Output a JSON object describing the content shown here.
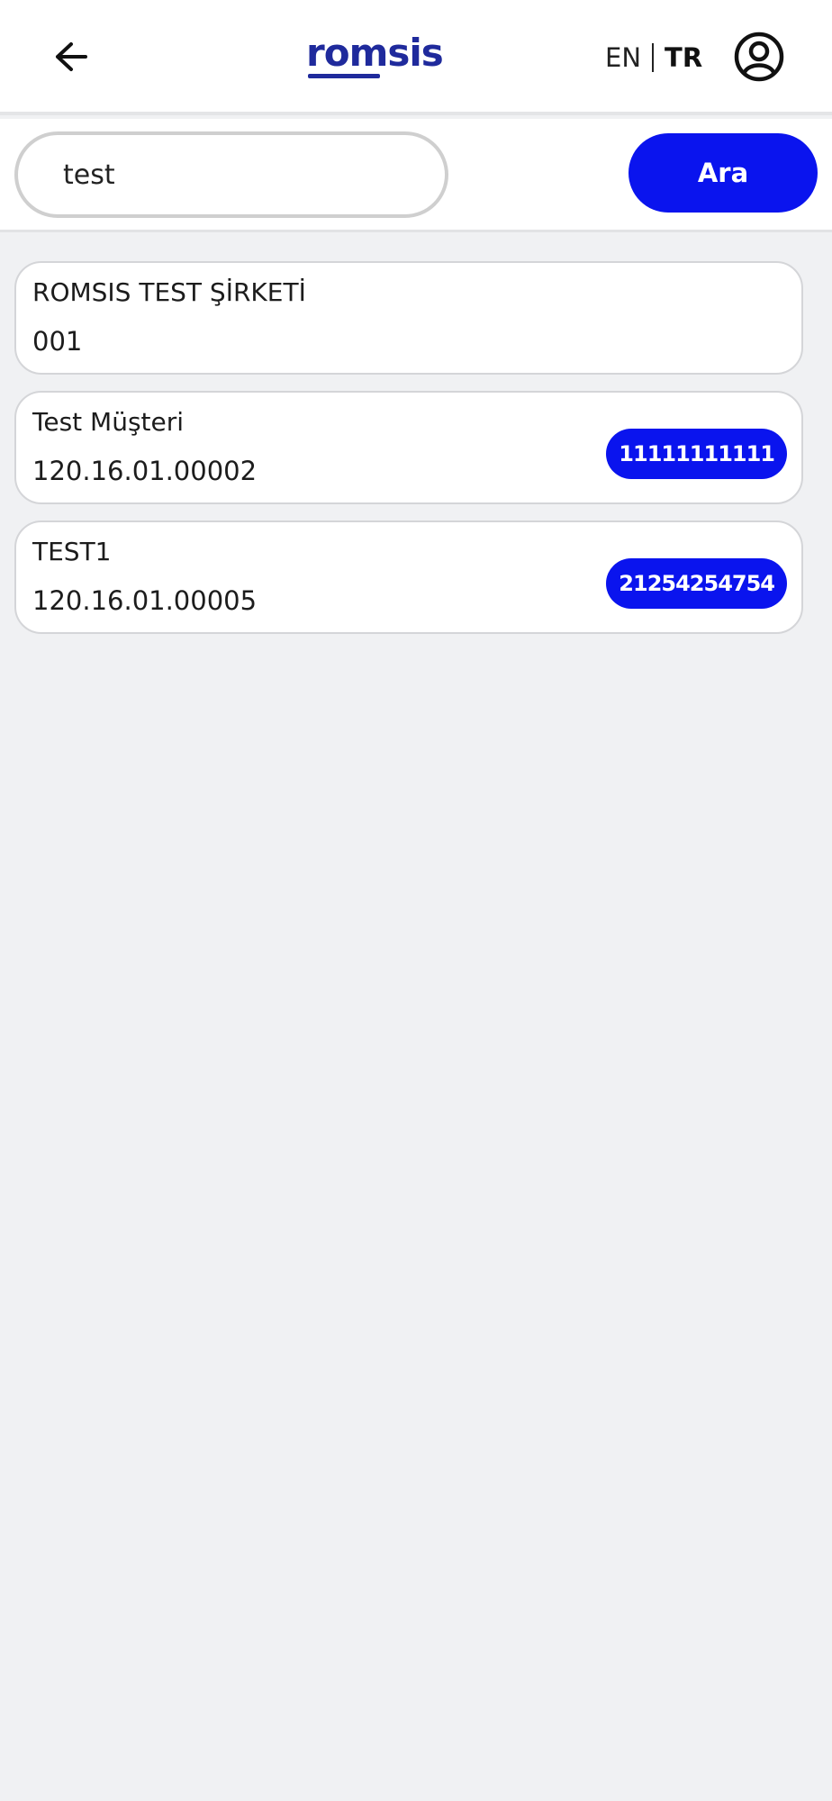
{
  "header": {
    "logo_text": "romsis",
    "lang_en": "EN",
    "lang_tr": "TR"
  },
  "search": {
    "value": "test",
    "button_label": "Ara"
  },
  "results": [
    {
      "name": "ROMSIS TEST ŞİRKETİ",
      "code": "001",
      "badge": ""
    },
    {
      "name": "Test Müşteri",
      "code": "120.16.01.00002",
      "badge": "11111111111"
    },
    {
      "name": "TEST1",
      "code": "120.16.01.00005",
      "badge": "21254254754"
    }
  ],
  "colors": {
    "accent": "#0a14ee",
    "logo": "#1f2a9c",
    "background": "#f0f1f3"
  }
}
